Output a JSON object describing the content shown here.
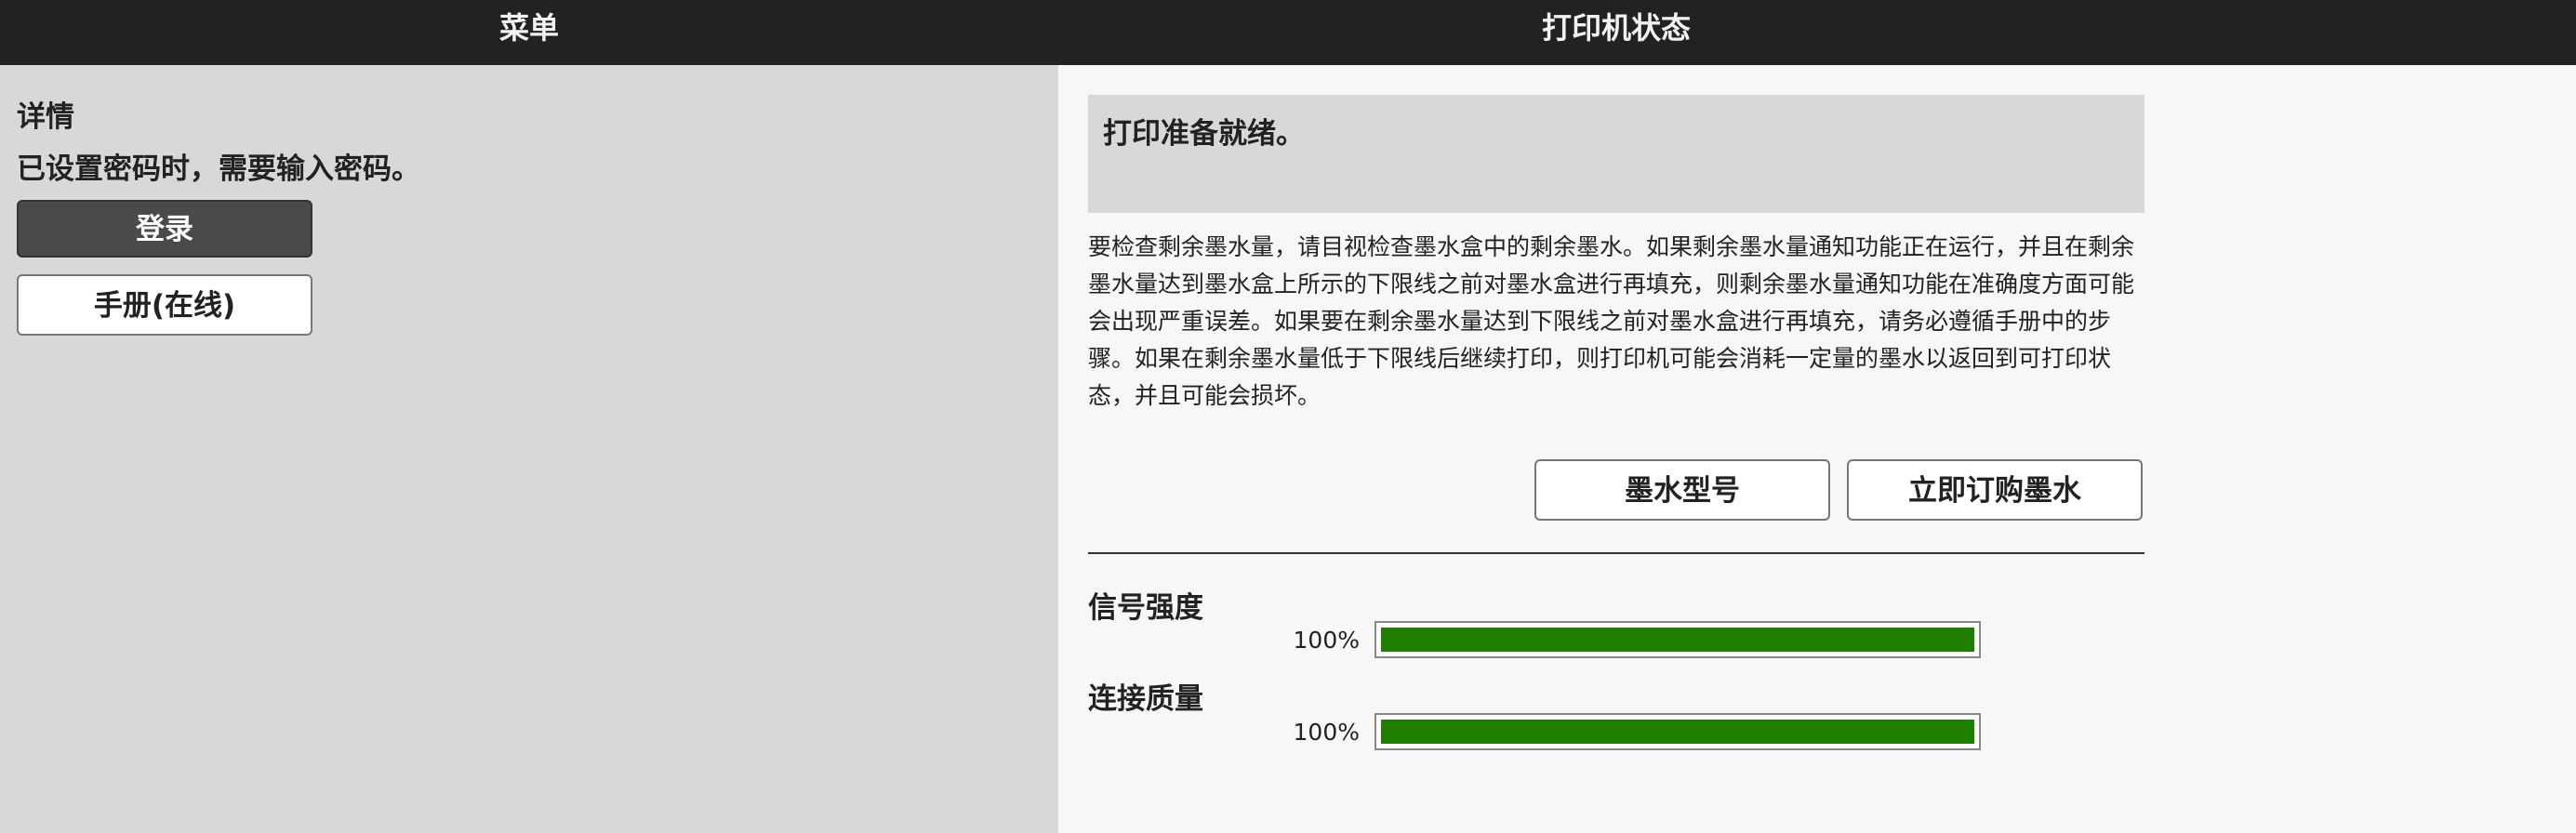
{
  "header": {
    "menu_title": "菜单",
    "status_title": "打印机状态"
  },
  "menu": {
    "section_title": "详情",
    "password_note": "已设置密码时，需要输入密码。",
    "login_label": "登录",
    "manual_label": "手册(在线)"
  },
  "status": {
    "ready_message": "打印准备就绪。",
    "ink_info": "要检查剩余墨水量，请目视检查墨水盒中的剩余墨水。如果剩余墨水量通知功能正在运行，并且在剩余墨水量达到墨水盒上所示的下限线之前对墨水盒进行再填充，则剩余墨水量通知功能在准确度方面可能会出现严重误差。如果要在剩余墨水量达到下限线之前对墨水盒进行再填充，请务必遵循手册中的步骤。如果在剩余墨水量低于下限线后继续打印，则打印机可能会消耗一定量的墨水以返回到可打印状态，并且可能会损坏。",
    "ink_model_label": "墨水型号",
    "order_ink_label": "立即订购墨水"
  },
  "metrics": {
    "signal_label": "信号强度",
    "signal_percent_text": "100%",
    "signal_value": 100,
    "quality_label": "连接质量",
    "quality_percent_text": "100%",
    "quality_value": 100
  },
  "colors": {
    "header_bg": "#222222",
    "left_bg": "#d8d8d8",
    "right_bg": "#f7f7f7",
    "bar_fill": "#1f8000",
    "login_button_bg": "#4a4a4a"
  }
}
